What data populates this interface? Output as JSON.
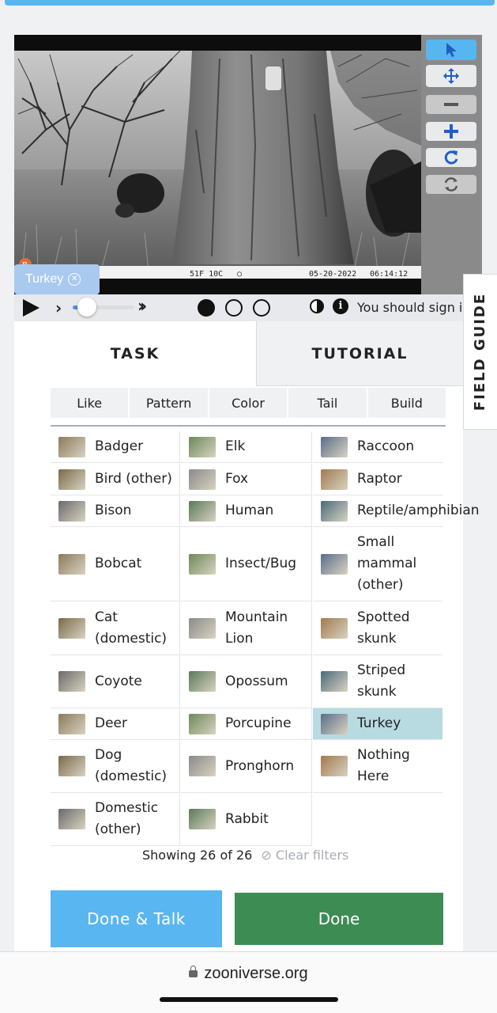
{
  "subject": {
    "stamp_temp": "51F 10C",
    "stamp_date": "05-20-2022",
    "stamp_time": "06:14:12",
    "selected_tag": "Turkey",
    "badge_letter": "B"
  },
  "toolbar": {
    "select_icon": "cursor-arrow-icon",
    "pan_icon": "move-arrows-icon",
    "zoom_out_icon": "minus-icon",
    "zoom_in_icon": "plus-icon",
    "rotate_icon": "rotate-icon",
    "reset_icon": "refresh-icon"
  },
  "playback": {
    "sign_in_message": "You should sign in"
  },
  "tabs": {
    "task": "TASK",
    "tutorial": "TUTORIAL"
  },
  "field_guide": "FIELD GUIDE",
  "filters": [
    "Like",
    "Pattern",
    "Color",
    "Tail",
    "Build"
  ],
  "choices": [
    {
      "label": "Badger"
    },
    {
      "label": "Elk"
    },
    {
      "label": "Raccoon"
    },
    {
      "label": "Bird (other)"
    },
    {
      "label": "Fox"
    },
    {
      "label": "Raptor"
    },
    {
      "label": "Bison"
    },
    {
      "label": "Human"
    },
    {
      "label": "Reptile/amphibian"
    },
    {
      "label": "Bobcat"
    },
    {
      "label": "Insect/Bug"
    },
    {
      "label": "Small mammal (other)",
      "lines": [
        "Small",
        "mammal",
        "(other)"
      ]
    },
    {
      "label": "Cat (domestic)",
      "lines": [
        "Cat",
        "(domestic)"
      ]
    },
    {
      "label": "Mountain Lion",
      "lines": [
        "Mountain",
        "Lion"
      ]
    },
    {
      "label": "Spotted skunk",
      "lines": [
        "Spotted",
        "skunk"
      ]
    },
    {
      "label": "Coyote"
    },
    {
      "label": "Opossum"
    },
    {
      "label": "Striped skunk",
      "lines": [
        "Striped",
        "skunk"
      ]
    },
    {
      "label": "Deer"
    },
    {
      "label": "Porcupine"
    },
    {
      "label": "Turkey",
      "selected": true
    },
    {
      "label": "Dog (domestic)",
      "lines": [
        "Dog",
        "(domestic)"
      ]
    },
    {
      "label": "Pronghorn"
    },
    {
      "label": "Nothing Here",
      "lines": [
        "Nothing",
        "Here"
      ]
    },
    {
      "label": "Domestic (other)",
      "lines": [
        "Domestic",
        "(other)"
      ]
    },
    {
      "label": "Rabbit"
    }
  ],
  "showing": {
    "text": "Showing 26 of 26",
    "clear": "Clear filters"
  },
  "buttons": {
    "done_talk": "Done & Talk",
    "done": "Done"
  },
  "browser": {
    "url": "zooniverse.org"
  },
  "colors": {
    "accent_blue": "#57b6f0",
    "done_green": "#3d8c54",
    "selected_bg": "#b7dbe0",
    "tag_chip": "#a9c9ef"
  }
}
